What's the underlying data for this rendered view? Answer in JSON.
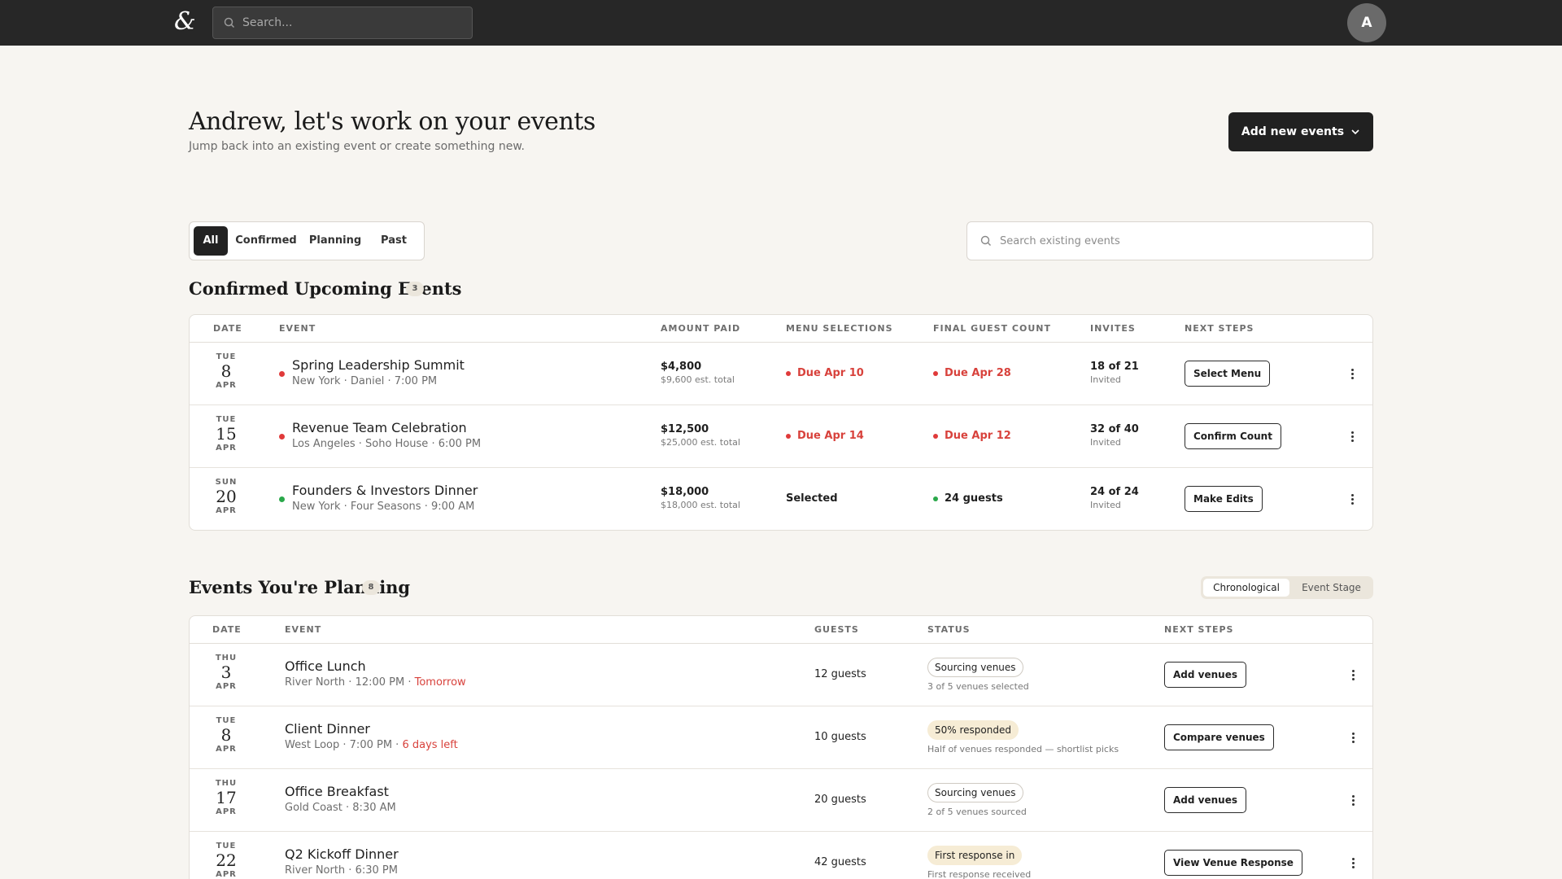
{
  "topbar": {
    "logo": "&",
    "search_placeholder": "Search...",
    "avatar_initial": "A"
  },
  "header": {
    "title": "Andrew, let's work on your events",
    "subtitle": "Jump back into an existing event or create something new.",
    "add_button": "Add new events"
  },
  "filters": {
    "tabs": [
      "All",
      "Confirmed",
      "Planning",
      "Past"
    ],
    "active": "All"
  },
  "event_search_placeholder": "Search existing events",
  "confirmed": {
    "title": "Confirmed Upcoming Events",
    "count": "3",
    "columns": [
      "DATE",
      "EVENT",
      "AMOUNT PAID",
      "MENU SELECTIONS",
      "FINAL GUEST COUNT",
      "INVITES",
      "NEXT STEPS"
    ],
    "rows": [
      {
        "dow": "TUE",
        "day": "8",
        "mon": "APR",
        "status_color": "red",
        "name": "Spring Leadership Summit",
        "meta": "New York · Daniel · 7:00 PM",
        "amount": "$4,800",
        "amount_sub": "$9,600 est. total",
        "menu": "Due Apr 10",
        "menu_state": "due",
        "guest_count": "Due Apr 28",
        "guest_state": "due",
        "invites": "18 of 21",
        "invites_sub": "Invited",
        "next_step": "Select Menu"
      },
      {
        "dow": "TUE",
        "day": "15",
        "mon": "APR",
        "status_color": "red",
        "name": "Revenue Team Celebration",
        "meta": "Los Angeles · Soho House · 6:00 PM",
        "amount": "$12,500",
        "amount_sub": "$25,000 est. total",
        "menu": "Due Apr 14",
        "menu_state": "due",
        "guest_count": "Due Apr 12",
        "guest_state": "due",
        "invites": "32 of 40",
        "invites_sub": "Invited",
        "next_step": "Confirm Count"
      },
      {
        "dow": "SUN",
        "day": "20",
        "mon": "APR",
        "status_color": "green",
        "name": "Founders & Investors Dinner",
        "meta": "New York · Four Seasons · 9:00 AM",
        "amount": "$18,000",
        "amount_sub": "$18,000 est. total",
        "menu": "Selected",
        "menu_state": "done",
        "guest_count": "24 guests",
        "guest_state": "ok",
        "invites": "24 of 24",
        "invites_sub": "Invited",
        "next_step": "Make Edits"
      }
    ]
  },
  "planning": {
    "title": "Events You're Planning",
    "count": "8",
    "toggle": [
      "Chronological",
      "Event Stage"
    ],
    "toggle_active": "Chronological",
    "columns": [
      "DATE",
      "EVENT",
      "GUESTS",
      "STATUS",
      "NEXT STEPS"
    ],
    "rows": [
      {
        "dow": "THU",
        "day": "3",
        "mon": "APR",
        "name": "Office Lunch",
        "meta": "River North · 12:00 PM · ",
        "urgent": "Tomorrow",
        "guests": "12 guests",
        "status": "Sourcing venues",
        "status_style": "outline",
        "status_sub": "3 of 5 venues selected",
        "next_step": "Add venues"
      },
      {
        "dow": "TUE",
        "day": "8",
        "mon": "APR",
        "name": "Client Dinner",
        "meta": "West Loop · 7:00 PM · ",
        "urgent": "6 days left",
        "guests": "10 guests",
        "status": "50% responded",
        "status_style": "warm",
        "status_sub": "Half of venues responded — shortlist picks",
        "next_step": "Compare venues"
      },
      {
        "dow": "THU",
        "day": "17",
        "mon": "APR",
        "name": "Office Breakfast",
        "meta": "Gold Coast · 8:30 AM",
        "urgent": "",
        "guests": "20 guests",
        "status": "Sourcing venues",
        "status_style": "outline",
        "status_sub": "2 of 5 venues sourced",
        "next_step": "Add venues"
      },
      {
        "dow": "TUE",
        "day": "22",
        "mon": "APR",
        "name": "Q2 Kickoff Dinner",
        "meta": "River North · 6:30 PM",
        "urgent": "",
        "guests": "42 guests",
        "status": "First response in",
        "status_style": "warm",
        "status_sub": "First response received",
        "next_step": "View Venue Response"
      }
    ]
  }
}
